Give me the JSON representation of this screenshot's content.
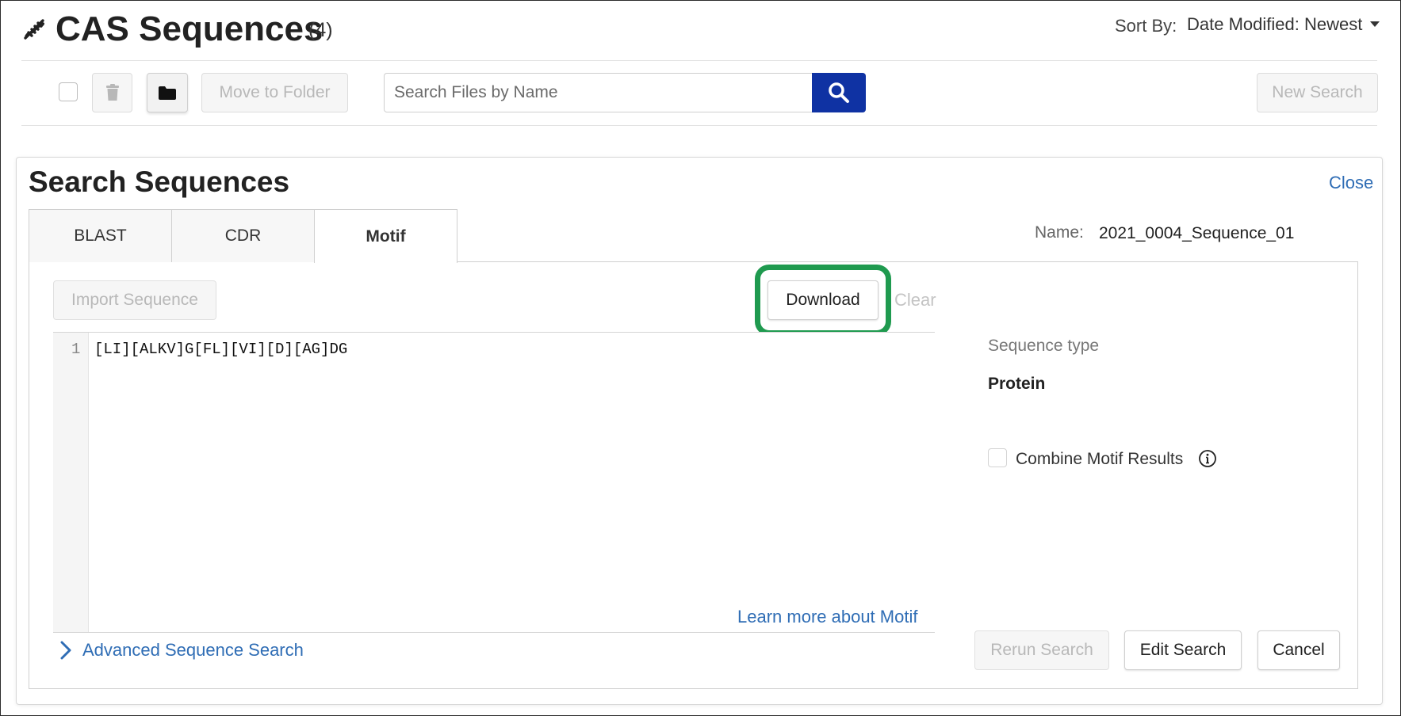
{
  "header": {
    "title": "CAS Sequences",
    "count": "(4)",
    "sort_label": "Sort By:",
    "sort_value": "Date Modified: Newest"
  },
  "toolbar": {
    "move_to_folder": "Move to Folder",
    "search_placeholder": "Search Files by Name",
    "new_search": "New Search"
  },
  "panel": {
    "title": "Search Sequences",
    "close": "Close",
    "tabs": [
      {
        "label": "BLAST",
        "active": false
      },
      {
        "label": "CDR",
        "active": false
      },
      {
        "label": "Motif",
        "active": true
      }
    ],
    "name_label": "Name:",
    "name_value": "2021_0004_Sequence_01",
    "import_sequence": "Import Sequence",
    "download": "Download",
    "clear": "Clear",
    "editor": {
      "line_number": "1",
      "code": "[LI][ALKV]G[FL][VI][D][AG]DG"
    },
    "learn_more": "Learn more about Motif",
    "advanced_search": "Advanced Sequence Search",
    "sequence_type_label": "Sequence type",
    "sequence_type_value": "Protein",
    "combine_motif_label": "Combine Motif Results",
    "rerun_search": "Rerun Search",
    "edit_search": "Edit Search",
    "cancel": "Cancel"
  },
  "colors": {
    "accent_blue": "#0f32a3",
    "link_blue": "#2f6db5",
    "highlight_green": "#1f9a4f"
  }
}
